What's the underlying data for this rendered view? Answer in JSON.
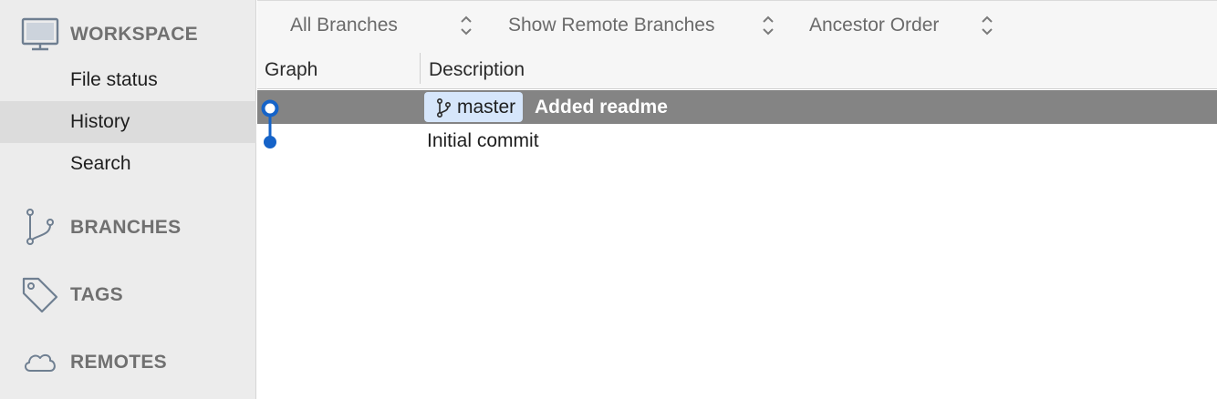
{
  "sidebar": {
    "workspace": {
      "label": "WORKSPACE",
      "icon": "monitor-icon",
      "items": [
        {
          "label": "File status"
        },
        {
          "label": "History",
          "selected": true
        },
        {
          "label": "Search"
        }
      ]
    },
    "sections": [
      {
        "label": "BRANCHES",
        "icon": "branch-icon"
      },
      {
        "label": "TAGS",
        "icon": "tag-icon"
      },
      {
        "label": "REMOTES",
        "icon": "cloud-icon"
      }
    ]
  },
  "toolbar": {
    "branches_filter": "All Branches",
    "remote_filter": "Show Remote Branches",
    "order_filter": "Ancestor Order"
  },
  "columns": {
    "graph": "Graph",
    "description": "Description"
  },
  "commits": [
    {
      "branch": "master",
      "message": "Added readme",
      "selected": true
    },
    {
      "branch": "",
      "message": "Initial commit",
      "selected": false
    }
  ],
  "colors": {
    "graph_line": "#1563c8",
    "selected_row": "#848484",
    "branch_tag": "#d6e6fb",
    "sidebar_bg": "#ececec"
  }
}
